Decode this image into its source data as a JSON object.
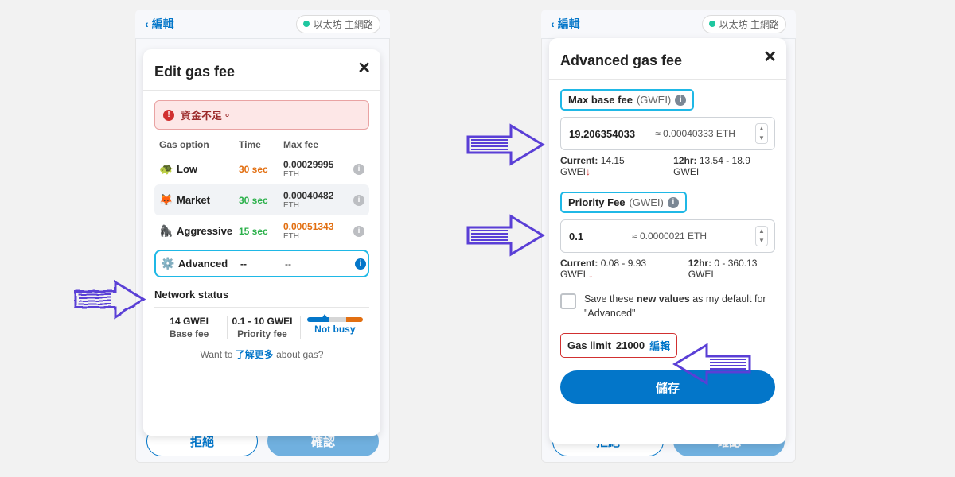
{
  "shared": {
    "back_label": "編輯",
    "network_name": "以太坊 主網路",
    "reject_label": "拒絕",
    "confirm_label": "確認"
  },
  "left": {
    "title": "Edit gas fee",
    "alert_text": "資金不足。",
    "columns": {
      "option": "Gas option",
      "time": "Time",
      "fee": "Max fee"
    },
    "rows": [
      {
        "emoji": "🐢",
        "name": "Low",
        "time": "30 sec",
        "time_class": "orange",
        "fee": "0.00029995",
        "unit": "ETH",
        "fee_class": "low",
        "selected": false
      },
      {
        "emoji": "🦊",
        "name": "Market",
        "time": "30 sec",
        "time_class": "green",
        "fee": "0.00040482",
        "unit": "ETH",
        "fee_class": "",
        "selected": true
      },
      {
        "emoji": "🦍",
        "name": "Aggressive",
        "time": "15 sec",
        "time_class": "green",
        "fee": "0.00051343",
        "unit": "ETH",
        "fee_class": "agg",
        "selected": false
      }
    ],
    "advanced": {
      "emoji": "⚙️",
      "name": "Advanced",
      "time": "--",
      "fee": "--"
    },
    "network_status_label": "Network status",
    "basefee_value": "14 GWEI",
    "basefee_label": "Base fee",
    "priority_value": "0.1 - 10 GWEI",
    "priority_label": "Priority fee",
    "busy_label": "Not busy",
    "learn_prefix": "Want to ",
    "learn_link": "了解更多",
    "learn_suffix": " about gas?"
  },
  "right": {
    "title": "Advanced gas fee",
    "maxbase": {
      "label": "Max base fee",
      "unit": "(GWEI)",
      "value": "19.206354033",
      "approx": "≈ 0.00040333 ETH",
      "current_label": "Current:",
      "current_value": "14.15 GWEI",
      "twelve_label": "12hr:",
      "twelve_value": "13.54 - 18.9 GWEI"
    },
    "priority": {
      "label": "Priority Fee",
      "unit": "(GWEI)",
      "value": "0.1",
      "approx": "≈ 0.0000021 ETH",
      "current_label": "Current:",
      "current_value": "0.08 - 9.93 GWEI",
      "twelve_label": "12hr:",
      "twelve_value": "0 - 360.13 GWEI"
    },
    "save_defaults_text_a": "Save these ",
    "save_defaults_text_b": "new values",
    "save_defaults_text_c": " as my default for \"Advanced\"",
    "gaslimit_label": "Gas limit",
    "gaslimit_value": "21000",
    "gaslimit_edit": "編輯",
    "save_button": "儲存"
  }
}
